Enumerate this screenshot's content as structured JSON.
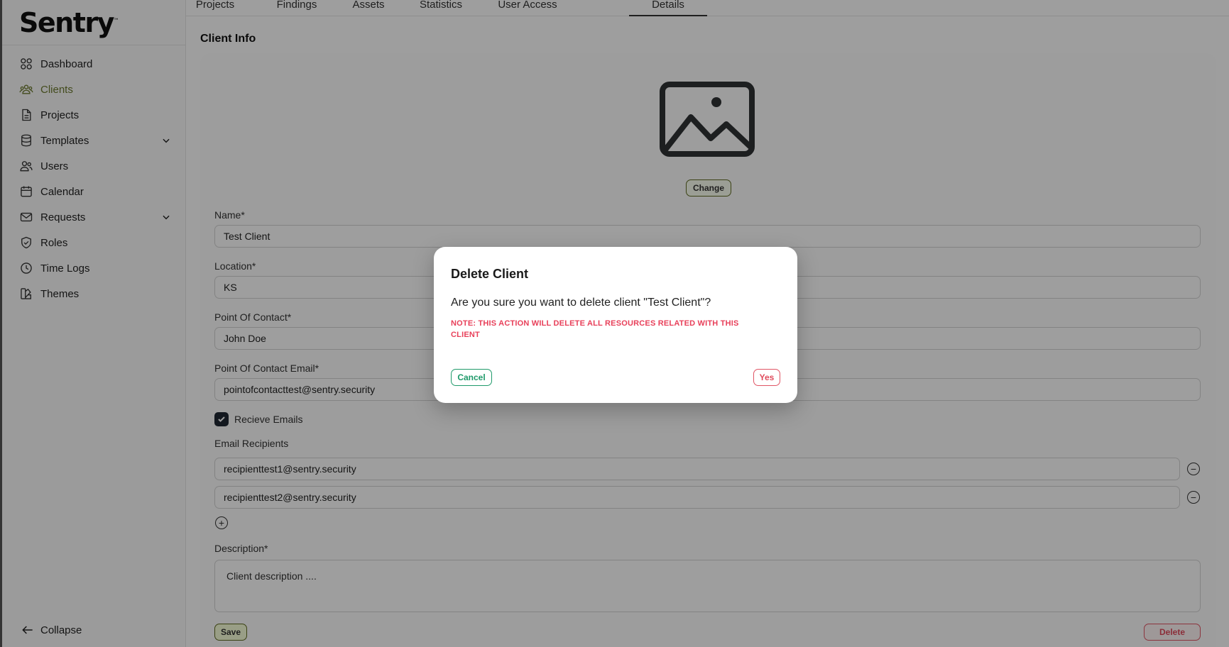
{
  "brand": {
    "logo_text": "Sentry",
    "trademark": "™"
  },
  "sidebar": {
    "items": [
      {
        "label": "Dashboard",
        "icon": "grid-icon"
      },
      {
        "label": "Clients",
        "icon": "users-group-icon",
        "active": true
      },
      {
        "label": "Projects",
        "icon": "document-icon"
      },
      {
        "label": "Templates",
        "icon": "database-icon",
        "expandable": true
      },
      {
        "label": "Users",
        "icon": "users-icon"
      },
      {
        "label": "Calendar",
        "icon": "calendar-icon"
      },
      {
        "label": "Requests",
        "icon": "mail-icon",
        "expandable": true
      },
      {
        "label": "Roles",
        "icon": "shield-icon"
      },
      {
        "label": "Time Logs",
        "icon": "clock-icon"
      },
      {
        "label": "Themes",
        "icon": "palette-icon"
      }
    ],
    "collapse_label": "Collapse"
  },
  "tabs": [
    {
      "label": "Projects"
    },
    {
      "label": "Findings"
    },
    {
      "label": "Assets"
    },
    {
      "label": "Statistics"
    },
    {
      "label": "User Access"
    },
    {
      "label": "Details",
      "active": true
    }
  ],
  "client_info": {
    "section_title": "Client Info",
    "change_label": "Change",
    "name_label": "Name*",
    "name_value": "Test Client",
    "location_label": "Location*",
    "location_value": "KS",
    "poc_label": "Point Of Contact*",
    "poc_value": "John Doe",
    "poc_email_label": "Point Of Contact Email*",
    "poc_email_value": "pointofcontacttest@sentry.security",
    "receive_emails_label": "Recieve Emails",
    "receive_emails_checked": true,
    "recipients_label": "Email Recipients",
    "recipients": [
      "recipienttest1@sentry.security",
      "recipienttest2@sentry.security"
    ],
    "description_label": "Description*",
    "description_value": "Client description ....",
    "save_label": "Save",
    "delete_label": "Delete"
  },
  "modal": {
    "title": "Delete Client",
    "message": "Are you sure you want to delete client \"Test Client\"?",
    "note": "NOTE: THIS ACTION WILL DELETE ALL RESOURCES RELATED WITH THIS CLIENT",
    "cancel_label": "Cancel",
    "yes_label": "Yes"
  },
  "colors": {
    "accent": "#6d7a2f",
    "cancel": "#1f9a6a",
    "danger": "#e04b5c"
  }
}
